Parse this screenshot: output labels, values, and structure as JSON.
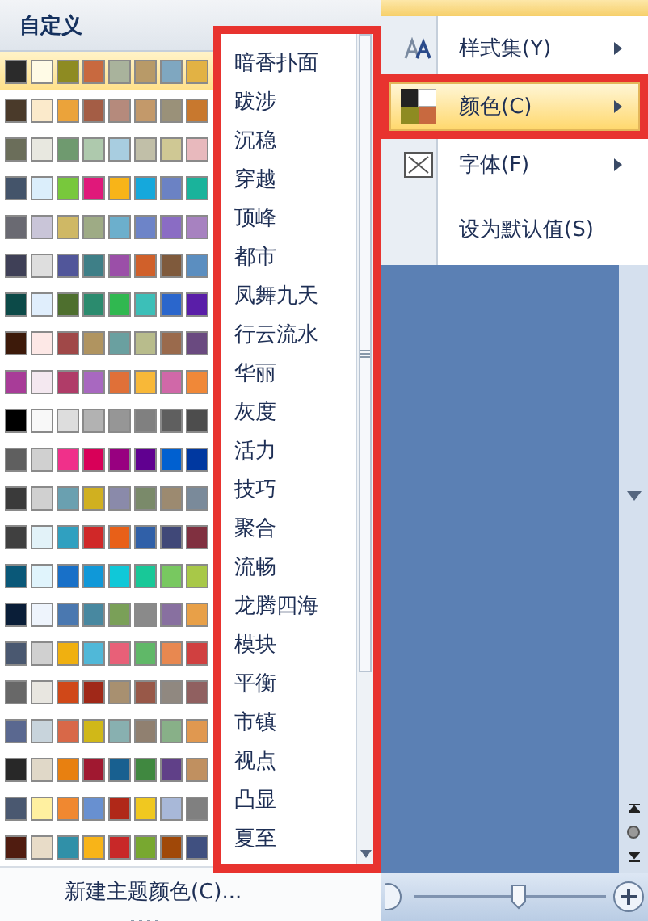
{
  "gallery": {
    "title": "自定义",
    "rows": [
      {
        "swatches": [
          {
            "color": "#2b2b2b"
          },
          {
            "color": "#fffbe6"
          },
          {
            "color": "#8e8b22"
          },
          {
            "color": "#c8693f"
          },
          {
            "color": "#a9b39c"
          },
          {
            "color": "#b89a68"
          },
          {
            "color": "#7fa7c0"
          },
          {
            "color": "#e2b244"
          }
        ],
        "selected": true
      },
      {
        "swatches": [
          {
            "color": "#4a3a2a"
          },
          {
            "color": "#fbeacb"
          },
          {
            "color": "#eba33a"
          },
          {
            "color": "#a45d45"
          },
          {
            "color": "#b58a7c"
          },
          {
            "color": "#c3996a"
          },
          {
            "color": "#9a9179"
          },
          {
            "color": "#c8782e"
          }
        ],
        "selected": false
      },
      {
        "swatches": [
          {
            "color": "#6b6e5a"
          },
          {
            "color": "#e8e8e0"
          },
          {
            "color": "#6f9a6f"
          },
          {
            "color": "#aec9ad"
          },
          {
            "color": "#a8cde0"
          },
          {
            "color": "#c1bfa8"
          },
          {
            "color": "#cfc894"
          },
          {
            "color": "#e8b9bd"
          }
        ],
        "selected": false
      },
      {
        "swatches": [
          {
            "color": "#44546a"
          },
          {
            "color": "#dbeefb"
          },
          {
            "color": "#78c83c"
          },
          {
            "color": "#e0187a"
          },
          {
            "color": "#f8b418"
          },
          {
            "color": "#15a8dc"
          },
          {
            "color": "#6b82c4"
          },
          {
            "color": "#1ab39b"
          }
        ],
        "selected": false
      },
      {
        "swatches": [
          {
            "color": "#6a6a72"
          },
          {
            "color": "#c9c5d8"
          },
          {
            "color": "#cfb865"
          },
          {
            "color": "#9eab85"
          },
          {
            "color": "#6cafcc"
          },
          {
            "color": "#6d84c8"
          },
          {
            "color": "#8a6cc4"
          },
          {
            "color": "#a782c0"
          }
        ],
        "selected": false
      },
      {
        "swatches": [
          {
            "color": "#3f4057"
          },
          {
            "color": "#dedede"
          },
          {
            "color": "#51569a"
          },
          {
            "color": "#3e7f87"
          },
          {
            "color": "#9b4fa8"
          },
          {
            "color": "#d0602a"
          },
          {
            "color": "#7f5a3c"
          },
          {
            "color": "#5b8ec0"
          }
        ],
        "selected": false
      },
      {
        "swatches": [
          {
            "color": "#0c4a48"
          },
          {
            "color": "#e0eefc"
          },
          {
            "color": "#4e6f2e"
          },
          {
            "color": "#2b8b6e"
          },
          {
            "color": "#30b850"
          },
          {
            "color": "#3cbfb8"
          },
          {
            "color": "#2a66cc"
          },
          {
            "color": "#5a1ea8"
          }
        ],
        "selected": false
      },
      {
        "swatches": [
          {
            "color": "#3d1a0a"
          },
          {
            "color": "#fde8e6"
          },
          {
            "color": "#a04848"
          },
          {
            "color": "#b09460"
          },
          {
            "color": "#6aa0a0"
          },
          {
            "color": "#b8bc8c"
          },
          {
            "color": "#9a6a4c"
          },
          {
            "color": "#6a4a80"
          }
        ],
        "selected": false
      },
      {
        "swatches": [
          {
            "color": "#a83c98"
          },
          {
            "color": "#f4e8f0"
          },
          {
            "color": "#b03c68"
          },
          {
            "color": "#a868c0"
          },
          {
            "color": "#e07038"
          },
          {
            "color": "#f8b838"
          },
          {
            "color": "#d068a8"
          },
          {
            "color": "#f08838"
          }
        ],
        "selected": false
      },
      {
        "swatches": [
          {
            "color": "#000000"
          },
          {
            "color": "#f8f8f8"
          },
          {
            "color": "#dddddd"
          },
          {
            "color": "#b2b2b2"
          },
          {
            "color": "#969696"
          },
          {
            "color": "#808080"
          },
          {
            "color": "#5f5f5f"
          },
          {
            "color": "#4d4d4d"
          }
        ],
        "selected": false
      },
      {
        "swatches": [
          {
            "color": "#5f5f5f"
          },
          {
            "color": "#d0d0d0"
          },
          {
            "color": "#f0308a"
          },
          {
            "color": "#d80058"
          },
          {
            "color": "#980080"
          },
          {
            "color": "#600090"
          },
          {
            "color": "#0060d0"
          },
          {
            "color": "#0038a0"
          }
        ],
        "selected": false
      },
      {
        "swatches": [
          {
            "color": "#3a3a3a"
          },
          {
            "color": "#d0d0d0"
          },
          {
            "color": "#6aa0b0"
          },
          {
            "color": "#d0b020"
          },
          {
            "color": "#8a8aaa"
          },
          {
            "color": "#7a8a6a"
          },
          {
            "color": "#9c8a70"
          },
          {
            "color": "#7a8a9a"
          }
        ],
        "selected": false
      },
      {
        "swatches": [
          {
            "color": "#404040"
          },
          {
            "color": "#e2f2f8"
          },
          {
            "color": "#30a0c0"
          },
          {
            "color": "#d02828"
          },
          {
            "color": "#e86018"
          },
          {
            "color": "#3060a8"
          },
          {
            "color": "#404878"
          },
          {
            "color": "#803040"
          }
        ],
        "selected": false
      },
      {
        "swatches": [
          {
            "color": "#0a5878"
          },
          {
            "color": "#e0f4fc"
          },
          {
            "color": "#1870c8"
          },
          {
            "color": "#1098d8"
          },
          {
            "color": "#10c8d8"
          },
          {
            "color": "#18c898"
          },
          {
            "color": "#78c860"
          },
          {
            "color": "#a8c848"
          }
        ],
        "selected": false
      },
      {
        "swatches": [
          {
            "color": "#0a1e38"
          },
          {
            "color": "#eef4fc"
          },
          {
            "color": "#4a78b0"
          },
          {
            "color": "#4888a0"
          },
          {
            "color": "#7aa058"
          },
          {
            "color": "#8a8a8a"
          },
          {
            "color": "#8870a0"
          },
          {
            "color": "#e8a048"
          }
        ],
        "selected": false
      },
      {
        "swatches": [
          {
            "color": "#4a5870"
          },
          {
            "color": "#d0d0d0"
          },
          {
            "color": "#f0b010"
          },
          {
            "color": "#50b8d8"
          },
          {
            "color": "#e86078"
          },
          {
            "color": "#60b868"
          },
          {
            "color": "#e88850"
          },
          {
            "color": "#d04040"
          }
        ],
        "selected": false
      },
      {
        "swatches": [
          {
            "color": "#686868"
          },
          {
            "color": "#e8e6e0"
          },
          {
            "color": "#d04818"
          },
          {
            "color": "#a02818"
          },
          {
            "color": "#a89070"
          },
          {
            "color": "#985848"
          },
          {
            "color": "#908880"
          },
          {
            "color": "#906060"
          }
        ],
        "selected": false
      },
      {
        "swatches": [
          {
            "color": "#5a6890"
          },
          {
            "color": "#c8d4dc"
          },
          {
            "color": "#d86848"
          },
          {
            "color": "#d0b818"
          },
          {
            "color": "#88b0b0"
          },
          {
            "color": "#908070"
          },
          {
            "color": "#88b088"
          },
          {
            "color": "#e09850"
          }
        ],
        "selected": false
      },
      {
        "swatches": [
          {
            "color": "#282828"
          },
          {
            "color": "#e0d8c8"
          },
          {
            "color": "#e88010"
          },
          {
            "color": "#a01830"
          },
          {
            "color": "#186090"
          },
          {
            "color": "#408840"
          },
          {
            "color": "#604088"
          },
          {
            "color": "#c09060"
          }
        ],
        "selected": false
      },
      {
        "swatches": [
          {
            "color": "#4a5870"
          },
          {
            "color": "#fff0a0"
          },
          {
            "color": "#f08830"
          },
          {
            "color": "#6890d0"
          },
          {
            "color": "#b02818"
          },
          {
            "color": "#f0c820"
          },
          {
            "color": "#a8b8d8"
          },
          {
            "color": "#808080"
          }
        ],
        "selected": false
      },
      {
        "swatches": [
          {
            "color": "#501c10"
          },
          {
            "color": "#e8dcc8"
          },
          {
            "color": "#3090a8"
          },
          {
            "color": "#f8b418"
          },
          {
            "color": "#c82828"
          },
          {
            "color": "#78a830"
          },
          {
            "color": "#a04808"
          },
          {
            "color": "#405080"
          }
        ],
        "selected": false
      }
    ],
    "names_framed": true,
    "names": [
      "暗香扑面",
      "跋涉",
      "沉稳",
      "穿越",
      "顶峰",
      "都市",
      "凤舞九天",
      "行云流水",
      "华丽",
      "灰度",
      "活力",
      "技巧",
      "聚合",
      "流畅",
      "龙腾四海",
      "模块",
      "平衡",
      "市镇",
      "视点",
      "凸显",
      "夏至"
    ],
    "footer": "新建主题颜色(C)..."
  },
  "menu": {
    "items": [
      {
        "kind": "styles",
        "label": "样式集(Y)",
        "submenu": true,
        "selected": false,
        "framed": false
      },
      {
        "kind": "colors",
        "label": "颜色(C)",
        "submenu": true,
        "selected": true,
        "framed": true
      },
      {
        "kind": "fonts",
        "label": "字体(F)",
        "submenu": true,
        "selected": false,
        "framed": false
      },
      {
        "kind": "plain",
        "label": "设为默认值(S)",
        "submenu": false,
        "selected": false,
        "framed": false
      }
    ]
  },
  "zoom": {
    "level": 0.55
  }
}
